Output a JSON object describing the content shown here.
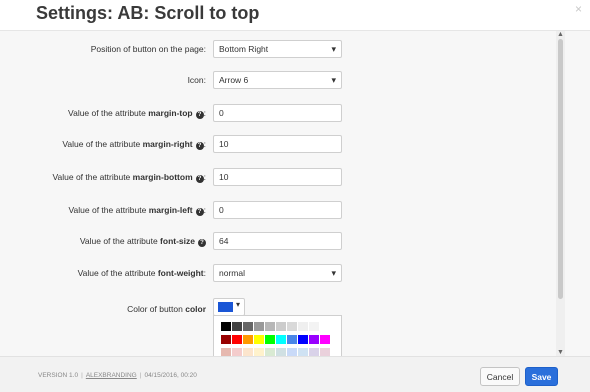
{
  "header": {
    "title": "Settings: AB: Scroll to top",
    "close_icon": "×"
  },
  "form": {
    "position": {
      "label": "Position of button on the page:",
      "value": "Bottom Right"
    },
    "icon": {
      "label": "Icon:",
      "value": "Arrow 6"
    },
    "margin_top": {
      "prefix": "Value of the attribute ",
      "attr": "margin-top",
      "value": "0"
    },
    "margin_right": {
      "prefix": "Value of the attribute ",
      "attr": "margin-right",
      "value": "10"
    },
    "margin_bottom": {
      "prefix": "Value of the attribute ",
      "attr": "margin-bottom",
      "value": "10"
    },
    "margin_left": {
      "prefix": "Value of the attribute ",
      "attr": "margin-left",
      "value": "0"
    },
    "font_size": {
      "prefix": "Value of the attribute ",
      "attr": "font-size",
      "value": "64"
    },
    "font_weight": {
      "prefix": "Value of the attribute ",
      "attr": "font-weight",
      "suffix": ":",
      "value": "normal"
    },
    "color": {
      "prefix": "Color of button ",
      "attr": "color",
      "swatch": "#1a56d6"
    }
  },
  "palette": {
    "rows": [
      [
        "#000000",
        "#434343",
        "#666666",
        "#999999",
        "#b7b7b7",
        "#cccccc",
        "#d9d9d9",
        "#efefef",
        "#f3f3f3",
        "#ffffff"
      ],
      [
        "#980000",
        "#ff0000",
        "#ff9900",
        "#ffff00",
        "#00ff00",
        "#00ffff",
        "#4a86e8",
        "#0000ff",
        "#9900ff",
        "#ff00ff"
      ],
      [
        "#e6b8af",
        "#f4cccc",
        "#fce5cd",
        "#fff2cc",
        "#d9ead3",
        "#d0e0e3",
        "#c9daf8",
        "#cfe2f3",
        "#d9d2e9",
        "#ead1dc"
      ]
    ]
  },
  "footer": {
    "version": "VERSION 1.0",
    "vendor": "ALEXBRANDING",
    "date": "04/15/2016, 00:20",
    "cancel_label": "Cancel",
    "save_label": "Save"
  },
  "colors": {
    "primary": "#2a6fdb",
    "help_icon": "#333333"
  },
  "icons": {
    "help": "help-icon",
    "close": "close-icon",
    "caret": "chevron-down-icon"
  }
}
